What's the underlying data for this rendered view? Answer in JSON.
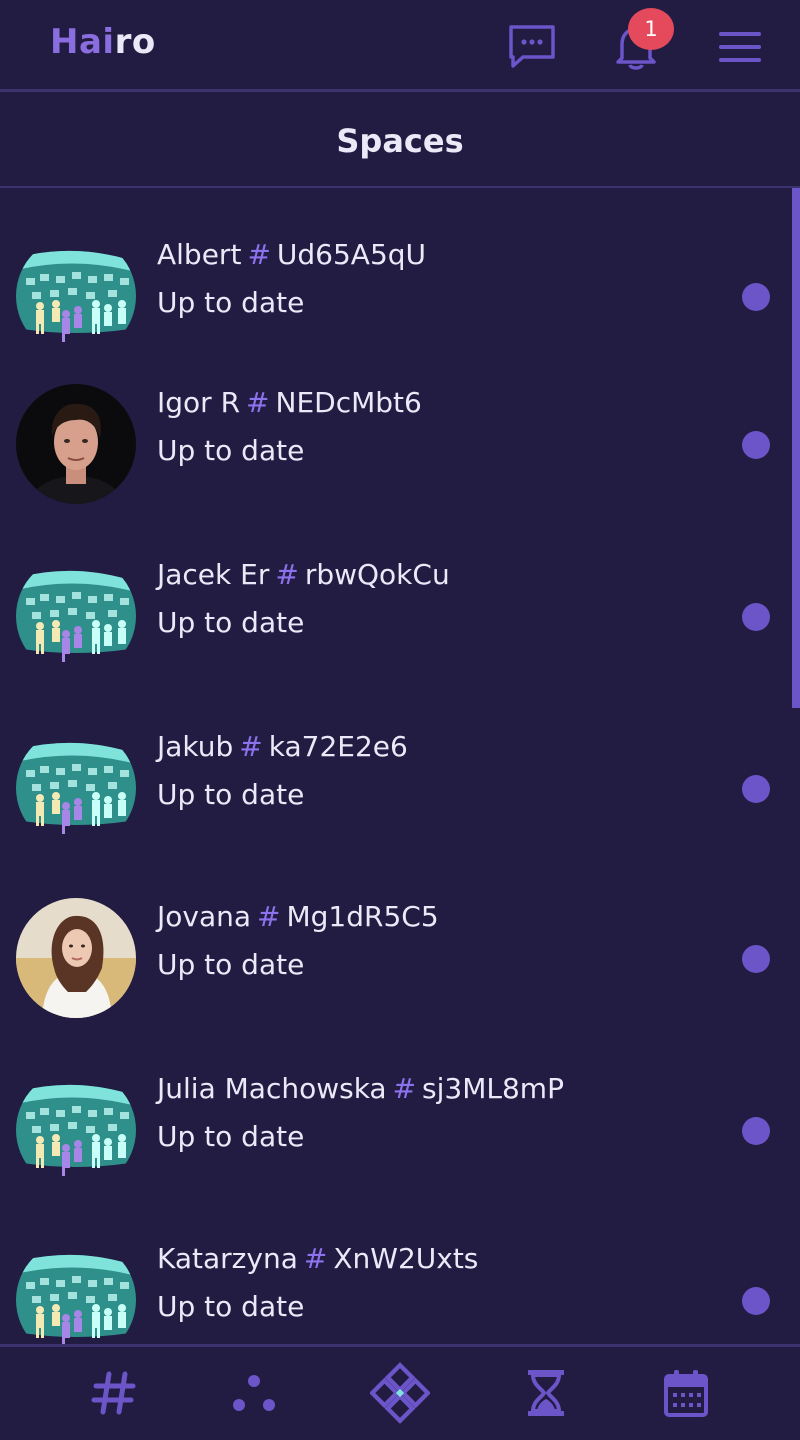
{
  "header": {
    "logo_part1": "Hai",
    "logo_part2": "ro",
    "notification_count": "1",
    "icons": [
      "chat-icon",
      "bell-icon",
      "menu-icon"
    ]
  },
  "page": {
    "title": "Spaces"
  },
  "spaces": [
    {
      "name": "Albert",
      "hash": "#",
      "code": "Ud65A5qU",
      "status": "Up to date",
      "avatar": "crowd"
    },
    {
      "name": "Igor R",
      "hash": "#",
      "code": "NEDcMbt6",
      "status": "Up to date",
      "avatar": "man"
    },
    {
      "name": "Jacek Er",
      "hash": "#",
      "code": "rbwQokCu",
      "status": "Up to date",
      "avatar": "crowd"
    },
    {
      "name": "Jakub",
      "hash": "#",
      "code": "ka72E2e6",
      "status": "Up to date",
      "avatar": "crowd"
    },
    {
      "name": "Jovana",
      "hash": "#",
      "code": "Mg1dR5C5",
      "status": "Up to date",
      "avatar": "woman"
    },
    {
      "name": "Julia Machowska",
      "hash": "#",
      "code": "sj3ML8mP",
      "status": "Up to date",
      "avatar": "crowd"
    },
    {
      "name": "Katarzyna",
      "hash": "#",
      "code": "XnW2Uxts",
      "status": "Up to date",
      "avatar": "crowd"
    }
  ],
  "bottom_nav": [
    "hash-icon",
    "dots-icon",
    "diamond-icon",
    "hourglass-icon",
    "calendar-icon"
  ],
  "colors": {
    "background": "#221c42",
    "accent": "#6b55c8",
    "accent_light": "#8d72ee",
    "badge": "#e44a5c",
    "divider": "#3b3370"
  }
}
